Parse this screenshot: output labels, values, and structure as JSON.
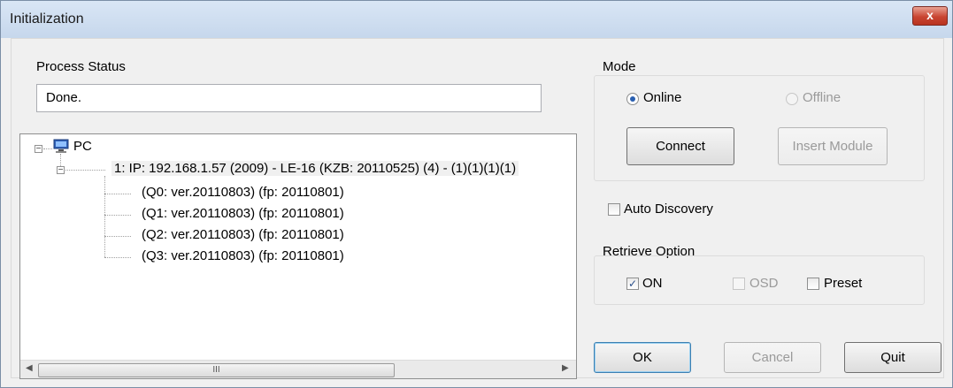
{
  "window": {
    "title": "Initialization",
    "close_glyph": "x"
  },
  "process_status": {
    "label": "Process Status",
    "value": "Done."
  },
  "tree": {
    "root_label": "PC",
    "device": "1: IP: 192.168.1.57 (2009) - LE-16 (KZB: 20110525) (4) - (1)(1)(1)(1)",
    "modules": [
      "(Q0: ver.20110803)  (fp: 20110801)",
      "(Q1: ver.20110803)  (fp: 20110801)",
      "(Q2: ver.20110803)  (fp: 20110801)",
      "(Q3: ver.20110803)  (fp: 20110801)"
    ],
    "scroll_thumb_glyph": "III"
  },
  "mode": {
    "label": "Mode",
    "online_label": "Online",
    "offline_label": "Offline",
    "selected": "Online",
    "connect_label": "Connect",
    "insert_module_label": "Insert Module"
  },
  "auto_discovery": {
    "label": "Auto Discovery",
    "checked": false
  },
  "retrieve_option": {
    "label": "Retrieve Option",
    "on_label": "ON",
    "on_checked": true,
    "osd_label": "OSD",
    "osd_checked": false,
    "osd_enabled": false,
    "preset_label": "Preset",
    "preset_checked": false
  },
  "buttons": {
    "ok": "OK",
    "cancel": "Cancel",
    "quit": "Quit"
  },
  "colors": {
    "titlebar": "#c6d7ec",
    "close": "#c94532",
    "radio_dot": "#2a5fb0"
  }
}
